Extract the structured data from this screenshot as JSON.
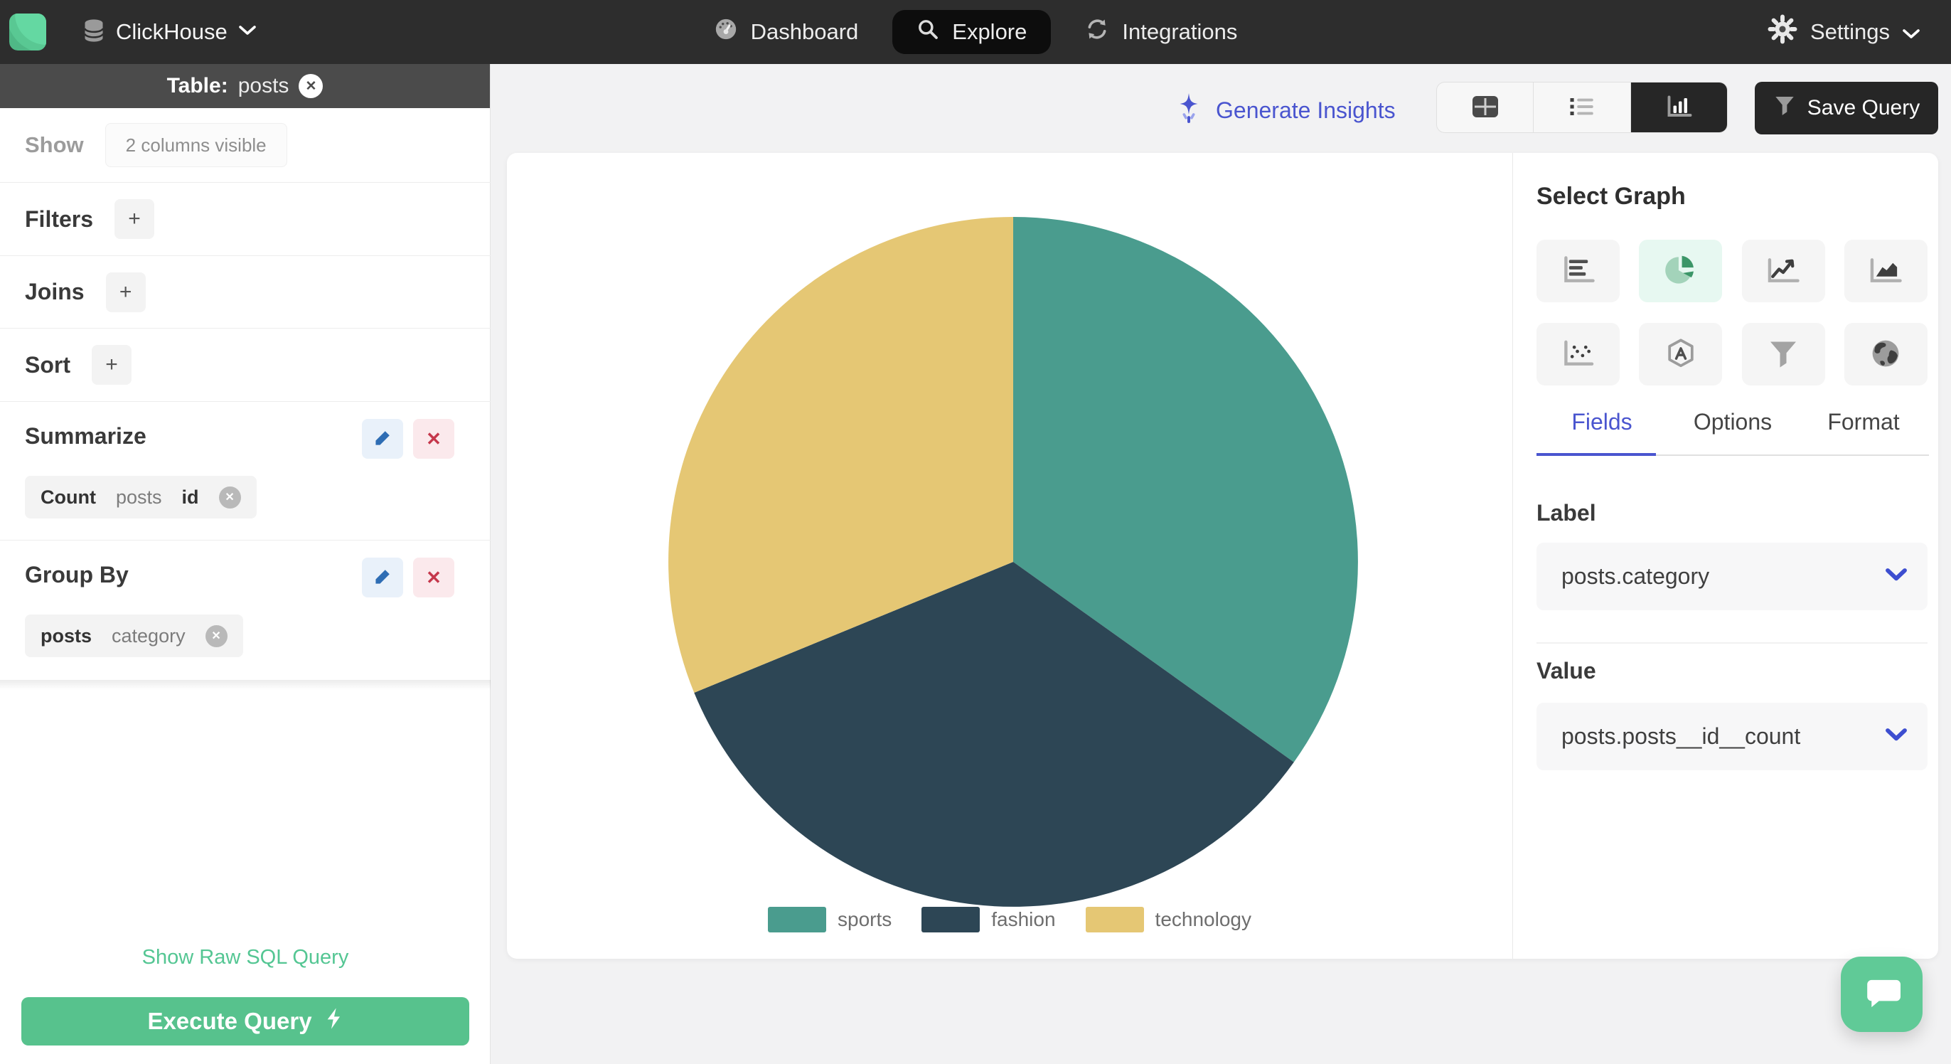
{
  "navbar": {
    "brand": "ClickHouse",
    "items": [
      {
        "label": "Dashboard",
        "icon": "gauge-icon",
        "active": false
      },
      {
        "label": "Explore",
        "icon": "search-icon",
        "active": true
      },
      {
        "label": "Integrations",
        "icon": "sync-icon",
        "active": false
      }
    ],
    "settings_label": "Settings"
  },
  "sidebar": {
    "table_bar": {
      "prefix": "Table:",
      "name": "posts"
    },
    "show": {
      "label": "Show",
      "pill": "2 columns visible"
    },
    "filters": {
      "label": "Filters",
      "add": "+"
    },
    "joins": {
      "label": "Joins",
      "add": "+"
    },
    "sort": {
      "label": "Sort",
      "add": "+"
    },
    "summarize": {
      "title": "Summarize",
      "chip": {
        "fn": "Count",
        "table": "posts",
        "column": "id"
      }
    },
    "group_by": {
      "title": "Group By",
      "chip": {
        "table": "posts",
        "column": "category"
      }
    },
    "raw_sql_link": "Show Raw SQL Query",
    "execute_button": "Execute Query"
  },
  "toolbar": {
    "generate_insights": "Generate Insights",
    "save_query": "Save Query",
    "view_toggle": [
      "table",
      "list",
      "chart"
    ],
    "active_view": "chart"
  },
  "graph_panel": {
    "title": "Select Graph",
    "graph_options": [
      "bar",
      "pie",
      "line",
      "area",
      "scatter",
      "radar",
      "funnel",
      "geo"
    ],
    "active_graph": "pie",
    "tabs": [
      "Fields",
      "Options",
      "Format"
    ],
    "active_tab": "Fields",
    "label_field": {
      "heading": "Label",
      "value": "posts.category"
    },
    "value_field": {
      "heading": "Value",
      "value": "posts.posts__id__count"
    }
  },
  "chart_data": {
    "type": "pie",
    "start_angle_deg": 0,
    "direction": "clockwise",
    "legend_position": "bottom",
    "slices": [
      {
        "label": "sports",
        "color": "#4a9c8e",
        "angle_deg": 125.5,
        "share_pct_est": 34.9
      },
      {
        "label": "fashion",
        "color": "#2d4655",
        "angle_deg": 122.2,
        "share_pct_est": 33.9
      },
      {
        "label": "technology",
        "color": "#e5c774",
        "angle_deg": 112.3,
        "share_pct_est": 31.2
      }
    ]
  },
  "colors": {
    "brand_green": "#5ecf9b",
    "accent_indigo": "#4a55cf",
    "navbar_bg": "#2d2d2d",
    "execute_green": "#57c28d",
    "link_green": "#54c693"
  }
}
